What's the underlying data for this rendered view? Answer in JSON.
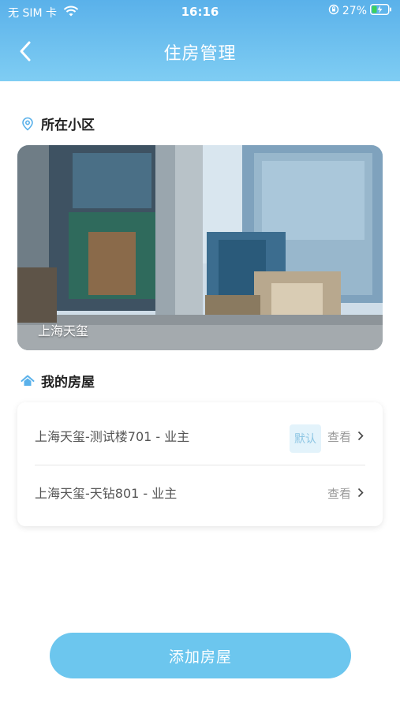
{
  "status_bar": {
    "carrier": "无 SIM 卡",
    "time": "16:16",
    "battery": "27%"
  },
  "nav": {
    "title": "住房管理"
  },
  "community": {
    "section_title": "所在小区",
    "name": "上海天玺"
  },
  "houses": {
    "section_title": "我的房屋",
    "items": [
      {
        "label": "上海天玺-测试楼701 - 业主",
        "badge": "默认",
        "action": "查看"
      },
      {
        "label": "上海天玺-天钻801 - 业主",
        "action": "查看"
      }
    ]
  },
  "footer": {
    "add_label": "添加房屋"
  },
  "colors": {
    "header_top": "#5ab1ea",
    "header_bottom": "#7fcdf3",
    "button": "#6cc6ee",
    "badge_bg": "#e3f3fb",
    "badge_text": "#8cc5e3"
  }
}
